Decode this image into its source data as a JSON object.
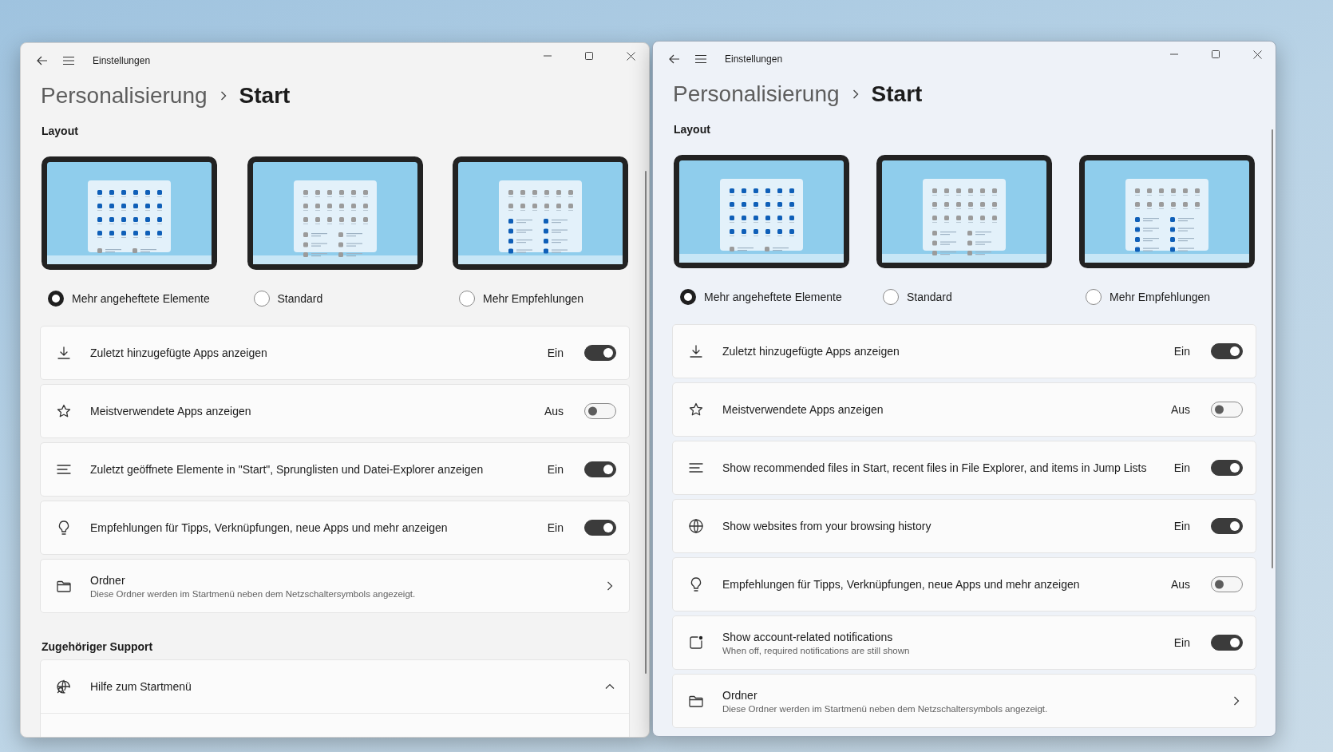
{
  "windows": [
    {
      "active": false,
      "title": "Einstellungen",
      "breadcrumb": {
        "parent": "Personalisierung",
        "current": "Start"
      },
      "layout": {
        "heading": "Layout",
        "options": [
          {
            "label": "Mehr angeheftete Elemente",
            "selected": true
          },
          {
            "label": "Standard",
            "selected": false
          },
          {
            "label": "Mehr Empfehlungen",
            "selected": false
          }
        ]
      },
      "settings": [
        {
          "kind": "toggle",
          "label": "Zuletzt hinzugefügte Apps anzeigen",
          "state_label": "Ein",
          "on": true
        },
        {
          "kind": "toggle",
          "label": "Meistverwendete Apps anzeigen",
          "state_label": "Aus",
          "on": false
        },
        {
          "kind": "toggle",
          "label": "Zuletzt geöffnete Elemente in \"Start\", Sprunglisten und Datei-Explorer anzeigen",
          "state_label": "Ein",
          "on": true
        },
        {
          "kind": "toggle",
          "label": "Empfehlungen für Tipps, Verknüpfungen, neue Apps und mehr anzeigen",
          "state_label": "Ein",
          "on": true
        },
        {
          "kind": "link",
          "label": "Ordner",
          "description": "Diese Ordner werden im Startmenü neben dem Netzschaltersymbols angezeigt."
        }
      ],
      "support": {
        "heading": "Zugehöriger Support",
        "items": [
          {
            "label": "Hilfe zum Startmenü",
            "expanded": true
          }
        ]
      }
    },
    {
      "active": true,
      "title": "Einstellungen",
      "breadcrumb": {
        "parent": "Personalisierung",
        "current": "Start"
      },
      "layout": {
        "heading": "Layout",
        "options": [
          {
            "label": "Mehr angeheftete Elemente",
            "selected": true
          },
          {
            "label": "Standard",
            "selected": false
          },
          {
            "label": "Mehr Empfehlungen",
            "selected": false
          }
        ]
      },
      "settings": [
        {
          "kind": "toggle",
          "label": "Zuletzt hinzugefügte Apps anzeigen",
          "state_label": "Ein",
          "on": true
        },
        {
          "kind": "toggle",
          "label": "Meistverwendete Apps anzeigen",
          "state_label": "Aus",
          "on": false
        },
        {
          "kind": "toggle",
          "label": "Show recommended files in Start, recent files in File Explorer, and items in Jump Lists",
          "state_label": "Ein",
          "on": true
        },
        {
          "kind": "toggle",
          "label": "Show websites from your browsing history",
          "state_label": "Ein",
          "on": true
        },
        {
          "kind": "toggle",
          "label": "Empfehlungen für Tipps, Verknüpfungen, neue Apps und mehr anzeigen",
          "state_label": "Aus",
          "on": false
        },
        {
          "kind": "toggle",
          "label": "Show account-related notifications",
          "description": "When off, required notifications are still shown",
          "state_label": "Ein",
          "on": true
        },
        {
          "kind": "link",
          "label": "Ordner",
          "description": "Diese Ordner werden im Startmenü neben dem Netzschaltersymbols angezeigt."
        }
      ]
    }
  ]
}
